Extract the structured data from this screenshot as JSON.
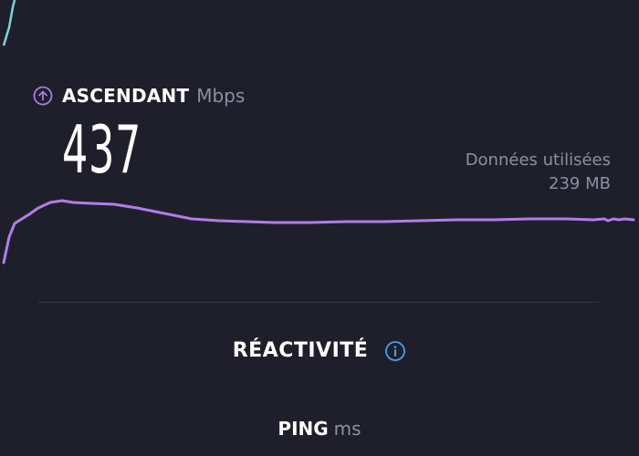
{
  "upload": {
    "label": "ASCENDANT",
    "unit": "Mbps",
    "value": "437",
    "icon": "arrow-up-circle-icon",
    "color": "#a77fe0"
  },
  "data_used": {
    "label": "Données utilisées",
    "value": "239 MB"
  },
  "reactivity": {
    "title": "RÉACTIVITÉ",
    "info_icon": "info-icon",
    "info_color": "#4a9fe8"
  },
  "ping": {
    "label": "PING",
    "unit": "ms"
  },
  "colors": {
    "background": "#1f1f2c",
    "muted_text": "#8e8ea0",
    "graph_line": "#b07ee6",
    "download_line": "#7fd3d8"
  }
}
